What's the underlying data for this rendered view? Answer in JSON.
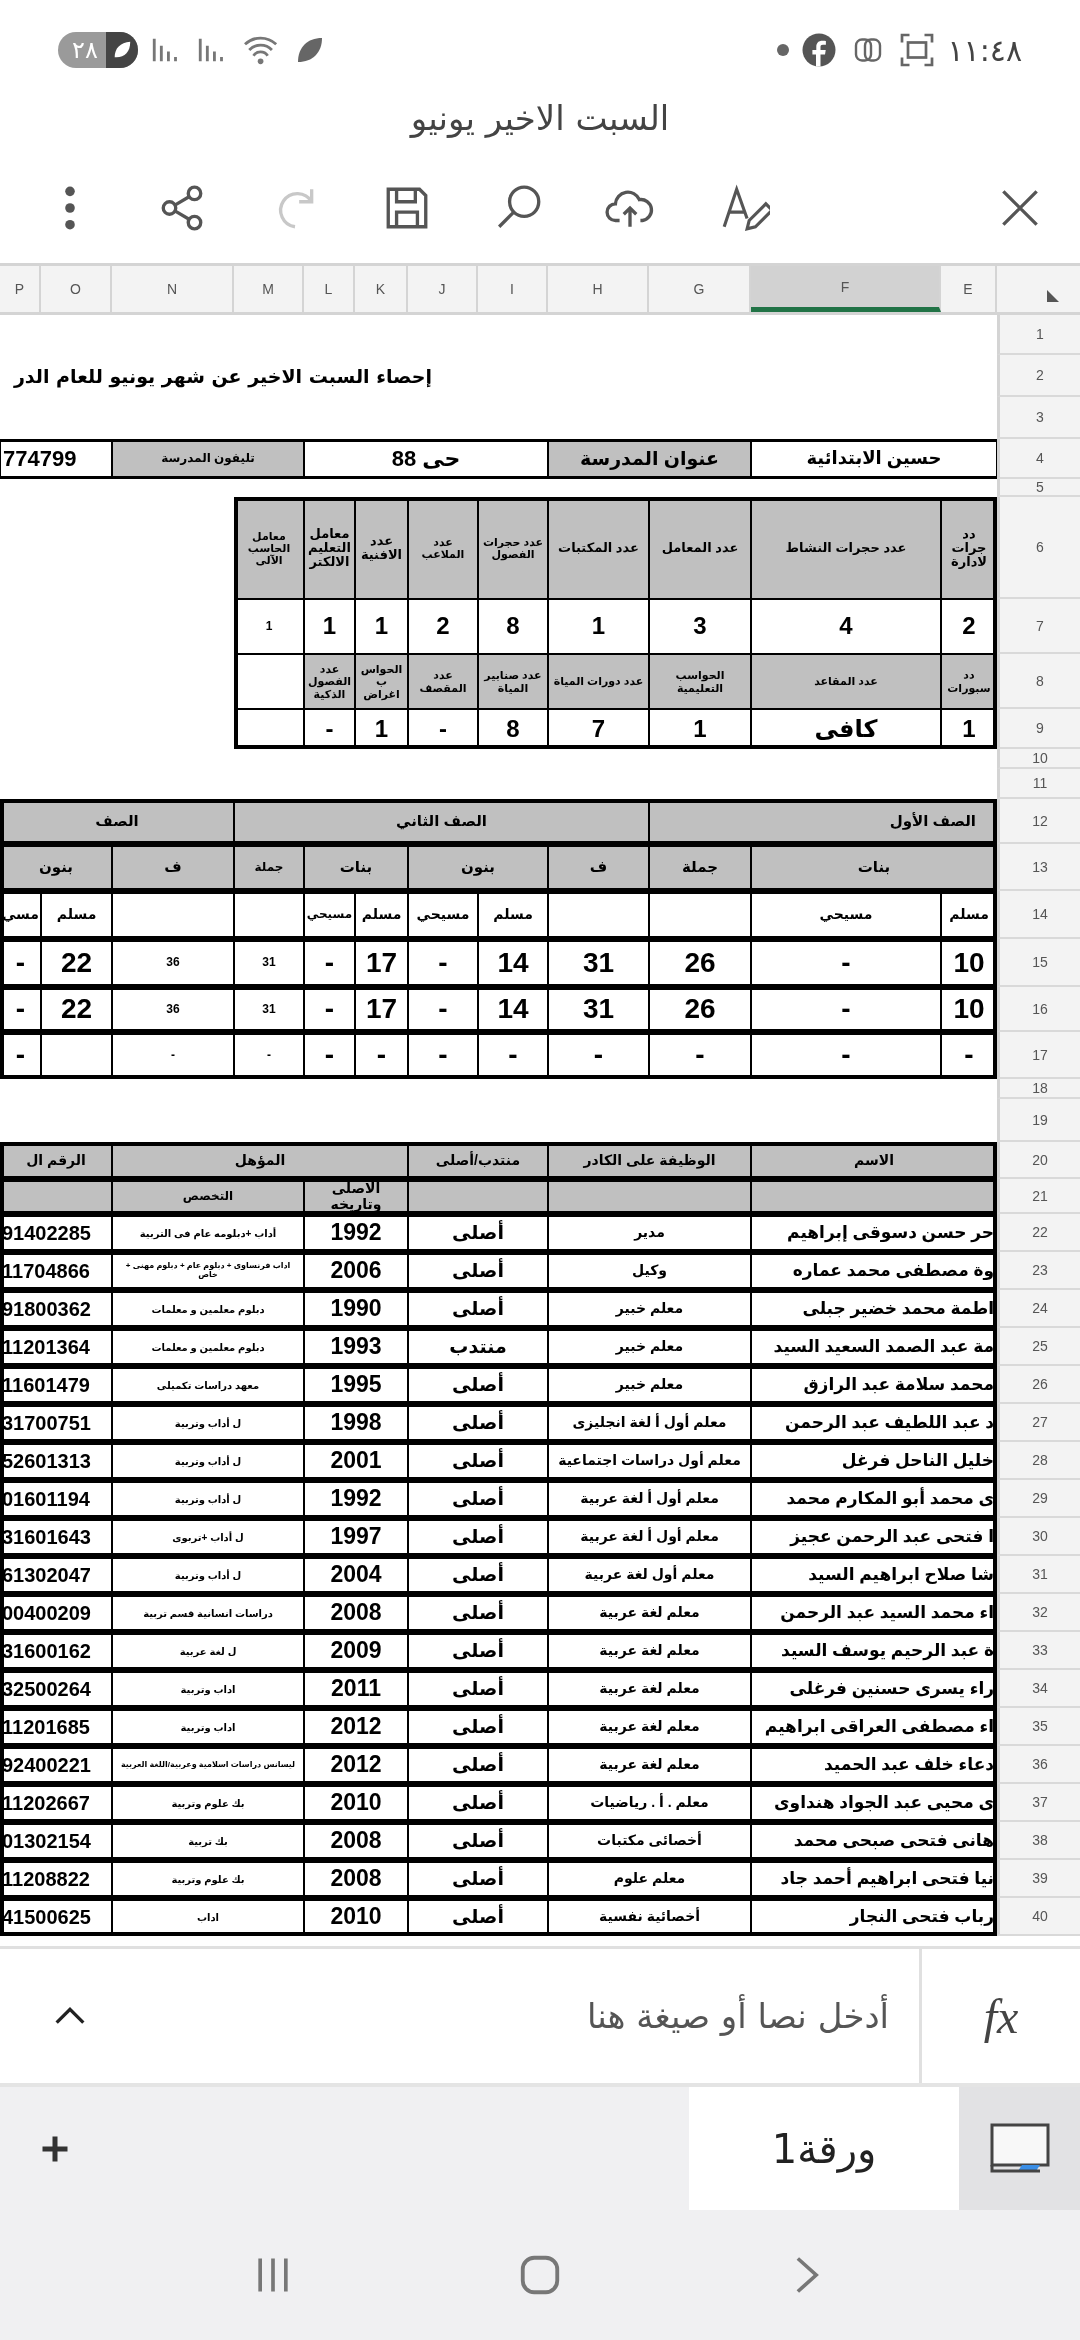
{
  "status_bar": {
    "time": "١١:٤٨",
    "battery": "٢٨"
  },
  "document_title": "السبت الاخير يونيو",
  "toolbar": [
    {
      "kind": "more",
      "disabled": false
    },
    {
      "kind": "share",
      "disabled": false
    },
    {
      "kind": "redo",
      "disabled": true
    },
    {
      "kind": "save",
      "disabled": false
    },
    {
      "kind": "search",
      "disabled": false
    },
    {
      "kind": "upload",
      "disabled": false
    },
    {
      "kind": "edit",
      "disabled": false
    },
    {
      "kind": "close",
      "disabled": false
    }
  ],
  "column_headers": [
    {
      "label": "E",
      "selected": false
    },
    {
      "label": "F",
      "selected": true
    },
    {
      "label": "G",
      "selected": false
    },
    {
      "label": "H",
      "selected": false
    },
    {
      "label": "I",
      "selected": false
    },
    {
      "label": "J",
      "selected": false
    },
    {
      "label": "K",
      "selected": false
    },
    {
      "label": "L",
      "selected": false
    },
    {
      "label": "M",
      "selected": false
    },
    {
      "label": "N",
      "selected": false
    },
    {
      "label": "O",
      "selected": false
    },
    {
      "label": "P",
      "selected": false
    }
  ],
  "row_numbers": [
    "1",
    "2",
    "3",
    "4",
    "5",
    "6",
    "7",
    "8",
    "9",
    "10",
    "11",
    "12",
    "13",
    "14",
    "15",
    "16",
    "17",
    "18",
    "19",
    "20",
    "21",
    "22",
    "23",
    "24",
    "25",
    "26",
    "27",
    "28",
    "29",
    "30",
    "31",
    "32",
    "33",
    "34",
    "35",
    "36",
    "37",
    "38",
    "39",
    "40"
  ],
  "sheet_title": "إحصاء السبت الاخير عن شهر يونيو للعام الدر",
  "school_info": [
    {
      "text": "حسين الابتدائية",
      "kind": "value"
    },
    {
      "text": "عنوان المدرسة",
      "kind": "header"
    },
    {
      "text": "حى 88",
      "kind": "value"
    },
    {
      "text": "تليفون المدرسة",
      "kind": "header"
    },
    {
      "text": "774799",
      "kind": "value"
    }
  ],
  "facilities": [
    [
      {
        "text": "دد جرات لادارة",
        "kind": "header"
      },
      {
        "text": "عدد حجرات النشاط",
        "kind": "header"
      },
      {
        "text": "عدد المعامل",
        "kind": "header"
      },
      {
        "text": "عدد المكتبات",
        "kind": "header"
      },
      {
        "text": "عدد حجرات الفصول",
        "kind": "header"
      },
      {
        "text": "عدد الملاعب",
        "kind": "header"
      },
      {
        "text": "عدد الافنية",
        "kind": "header"
      },
      {
        "text": "معامل التعليم الالكتر",
        "kind": "header"
      },
      {
        "text": "معامل الحاسب الآلى",
        "kind": "header"
      }
    ],
    [
      {
        "text": "2",
        "kind": "value"
      },
      {
        "text": "4",
        "kind": "value"
      },
      {
        "text": "3",
        "kind": "value"
      },
      {
        "text": "1",
        "kind": "value"
      },
      {
        "text": "8",
        "kind": "value"
      },
      {
        "text": "2",
        "kind": "value"
      },
      {
        "text": "1",
        "kind": "value"
      },
      {
        "text": "1",
        "kind": "value"
      },
      {
        "text": "1",
        "kind": "value"
      }
    ],
    [
      {
        "text": "دد سبورات",
        "kind": "header"
      },
      {
        "text": "عدد المقاعد",
        "kind": "header"
      },
      {
        "text": "الحواسب التعليمية",
        "kind": "header"
      },
      {
        "text": "عدد دورات المياة",
        "kind": "header"
      },
      {
        "text": "عدد صنابير المياة",
        "kind": "header"
      },
      {
        "text": "عدد المقصف",
        "kind": "header"
      },
      {
        "text": "الحواس ب اغراض",
        "kind": "header"
      },
      {
        "text": "عدد الفصول الذكية",
        "kind": "header"
      }
    ],
    [
      {
        "text": "1",
        "kind": "value"
      },
      {
        "text": "كافى",
        "kind": "value"
      },
      {
        "text": "1",
        "kind": "value"
      },
      {
        "text": "7",
        "kind": "value"
      },
      {
        "text": "8",
        "kind": "value"
      },
      {
        "text": "-",
        "kind": "value"
      },
      {
        "text": "1",
        "kind": "value"
      },
      {
        "text": "-",
        "kind": "value"
      }
    ]
  ],
  "classes": [
    [
      "الصف الأول",
      "الصف الثاني",
      "الصف"
    ],
    [
      "بنات",
      "جملة",
      "ف",
      "بنون",
      "بنات",
      "جملة",
      "ف",
      "بنون"
    ],
    [
      "مسلم",
      "مسيحي",
      "مسلم",
      "مسيحي",
      "مسلم",
      "مسيحي",
      "مسلم",
      "مسي"
    ],
    [
      "10",
      "-",
      "26",
      "31",
      "14",
      "-",
      "17",
      "-",
      "31",
      "36",
      "22",
      "-"
    ],
    [
      "10",
      "-",
      "26",
      "31",
      "14",
      "-",
      "17",
      "-",
      "31",
      "36",
      "22",
      "-"
    ],
    [
      "-",
      "-",
      "-",
      "-",
      "-",
      "-",
      "-",
      "-",
      "-",
      "-",
      "-"
    ]
  ],
  "staff": {
    "headers": [
      "الاسم",
      "الوظيفة على الكادر",
      "منتدب/أصلى",
      "المؤهل",
      "الرقم ال"
    ],
    "subheaders": [
      "الاصلى وتاريخه",
      "التخصص"
    ],
    "rows": [
      [
        "حر حسن دسوقى إبراهيم",
        "مدير",
        "أصلى",
        "1992",
        "أداب +دبلومه عام فى التربية",
        "91402285"
      ],
      [
        "وة مصطفى محمد عماره",
        "وكيل",
        "أصلى",
        "2006",
        "اداب فرنساوى + دبلوم عام + دبلوم مهنى + خاص",
        "11704866"
      ],
      [
        "اطمة محمد خضير جبلى",
        "معلم خبير",
        "أصلى",
        "1990",
        "دبلوم معلمين و معلمات",
        "91800362"
      ],
      [
        "مة عبد الصمد السعيد السيد",
        "معلم خبير",
        "منتدب",
        "1993",
        "دبلوم معلمين و معلمات",
        "11201364"
      ],
      [
        "محمد سلامة عبد الرازق",
        "معلم خبير",
        "أصلى",
        "1995",
        "معهد دراسات تكميلى",
        "11601479"
      ],
      [
        "د عبد اللطيف عبد الرحمن",
        "معلم أول أ لغة انجليزى",
        "أصلى",
        "1998",
        "ل أداب وتربية",
        "31700751"
      ],
      [
        "خليل الناحل فرغل",
        "معلم أول دراسات اجتماعية",
        "أصلى",
        "2001",
        "ل أداب وتربية",
        "52601313"
      ],
      [
        "ى محمد أبو المكارم محمد",
        "معلم أول أ لغة عربية",
        "أصلى",
        "1992",
        "ل أداب وتربية",
        "01601194"
      ],
      [
        "ا فتحى عبد الرحمن عجيز",
        "معلم أول أ لغة عربية",
        "أصلى",
        "1997",
        "ل أداب +تربوى",
        "31601643"
      ],
      [
        "شا صلاح ابراهيم السيد",
        "معلم أول لغة عربية",
        "أصلى",
        "2004",
        "ل أداب وتربية",
        "61302047"
      ],
      [
        "اء محمد السيد عبد الرحمن",
        "معلم   لغة عربية",
        "أصلى",
        "2008",
        "دراسات انسانية قسم تربية",
        "00400209"
      ],
      [
        "ة عبد الرحيم يوسف السيد",
        "معلم   لغة عربية",
        "أصلى",
        "2009",
        "ل لغة عربية",
        "31600162"
      ],
      [
        "راء يسرى حسنين فرغلى",
        "معلم   لغة عربية",
        "أصلى",
        "2011",
        "اداب وتربية",
        "32500264"
      ],
      [
        "اء مصطفى العراقى ابراهيم",
        "معلم   لغة عربية",
        "أصلى",
        "2012",
        "اداب وتربية",
        "11201685"
      ],
      [
        "دعاء خلف عبد الحميد",
        "معلم لغة عربية",
        "أصلى",
        "2012",
        "ليسانس دراسات اسلامية وعربية/اللغة العربية",
        "92400221"
      ],
      [
        "ى محيى عبد الجواد هنداوى",
        "معلم . أ . رياضيات",
        "أصلى",
        "2010",
        "بك علوم وتربية",
        "11202667"
      ],
      [
        "هانى فتحى صبحى محمد",
        "أخصائى مكتبات",
        "أصلى",
        "2008",
        "بك تربية",
        "01302154"
      ],
      [
        "نيا فتحى ابراهيم أحمد جاد",
        "معلم علوم",
        "أصلى",
        "2008",
        "بك علوم وتربية",
        "11208822"
      ],
      [
        "رباب فتحى النجار",
        "أخصائية نفسية",
        "أصلى",
        "2010",
        "اداب",
        "41500625"
      ]
    ]
  },
  "formula_bar": {
    "function_label": "fx",
    "placeholder": "أدخل نصا أو صيغة هنا"
  },
  "sheet_tabs": [
    {
      "label": "ورقة1",
      "selected": true
    }
  ]
}
